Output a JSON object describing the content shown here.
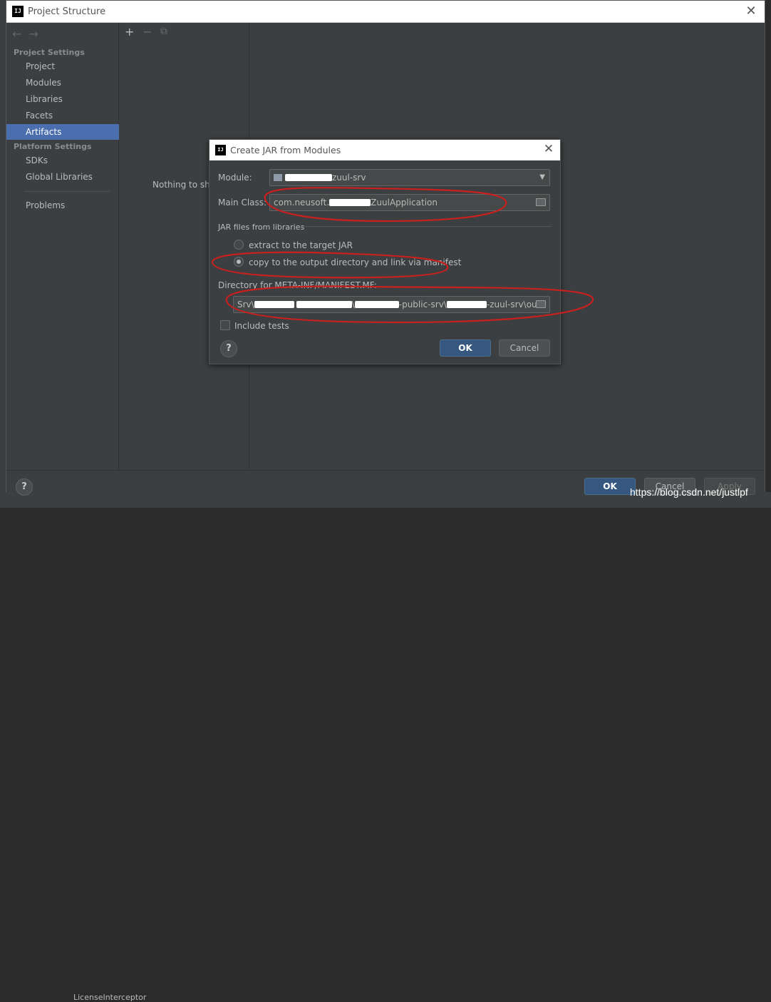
{
  "window": {
    "title": "Project Structure",
    "logo": "IJ"
  },
  "sidebar": {
    "project_settings_header": "Project Settings",
    "project_items": [
      "Project",
      "Modules",
      "Libraries",
      "Facets",
      "Artifacts"
    ],
    "selected_item": "Artifacts",
    "platform_settings_header": "Platform Settings",
    "platform_items": [
      "SDKs",
      "Global Libraries"
    ],
    "problems": "Problems"
  },
  "toolbar": {
    "add": "+",
    "remove": "−",
    "copy": "⧉"
  },
  "middle": {
    "empty_text": "Nothing to sho"
  },
  "footer": {
    "help": "?",
    "ok": "OK",
    "cancel": "Cancel",
    "apply": "Apply"
  },
  "background": {
    "bottom_text": "LicenseInterceptor"
  },
  "watermark": "https://blog.csdn.net/justlpf",
  "dialog": {
    "title": "Create JAR from Modules",
    "logo": "IJ",
    "module_label": "Module:",
    "module_value": "zuul-srv",
    "main_class_label": "Main Class:",
    "main_class_prefix": "com.neusoft.",
    "main_class_suffix": "ZuulApplication",
    "jar_group_label": "JAR files from libraries",
    "radio_extract": "extract to the target JAR",
    "radio_copy": "copy to the output directory and link via manifest",
    "selected_radio": "copy",
    "manifest_label": "Directory for META-INF/MANIFEST.MF:",
    "manifest_parts": [
      "Srv\\",
      "\\",
      "-public-srv\\",
      "-zuul-srv\\out"
    ],
    "include_tests": "Include tests",
    "include_tests_checked": false,
    "help": "?",
    "ok": "OK",
    "cancel": "Cancel"
  },
  "colors": {
    "selection": "#4b6eaf",
    "primary_button": "#365880",
    "annotation": "#c8201e"
  }
}
